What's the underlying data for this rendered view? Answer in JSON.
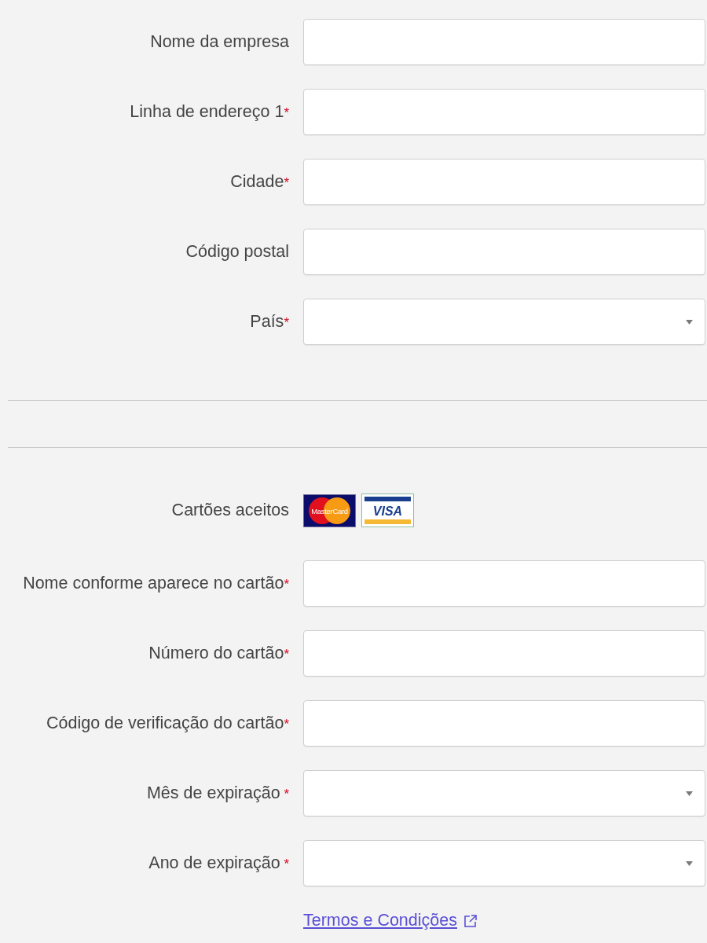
{
  "address_section": {
    "fields": [
      {
        "label": "Nome da empresa",
        "kind": "text"
      },
      {
        "label": "Linha de endereço 1",
        "required_mark": "*",
        "kind": "text"
      },
      {
        "label": "Cidade",
        "required_mark": "*",
        "kind": "text"
      },
      {
        "label": "Código postal",
        "kind": "text"
      },
      {
        "label": "País",
        "required_mark": "*",
        "kind": "select"
      }
    ]
  },
  "payment_section": {
    "accepted_cards": {
      "label": "Cartões aceitos",
      "cards": [
        {
          "kind": "mastercard",
          "text": "MasterCard"
        },
        {
          "kind": "visa",
          "text": "VISA"
        }
      ]
    },
    "fields": [
      {
        "label": "Nome conforme aparece no cartão",
        "required_mark": "*",
        "kind": "text"
      },
      {
        "label": "Número do cartão",
        "required_mark": "*",
        "kind": "text"
      },
      {
        "label": "Código de verificação do cartão",
        "required_mark": "*",
        "kind": "text"
      },
      {
        "label": "Mês de expiração",
        "required_mark": " *",
        "kind": "select"
      },
      {
        "label": "Ano de expiração",
        "required_mark": " *",
        "kind": "select"
      }
    ]
  },
  "terms_link": {
    "text": "Termos e Condições"
  }
}
